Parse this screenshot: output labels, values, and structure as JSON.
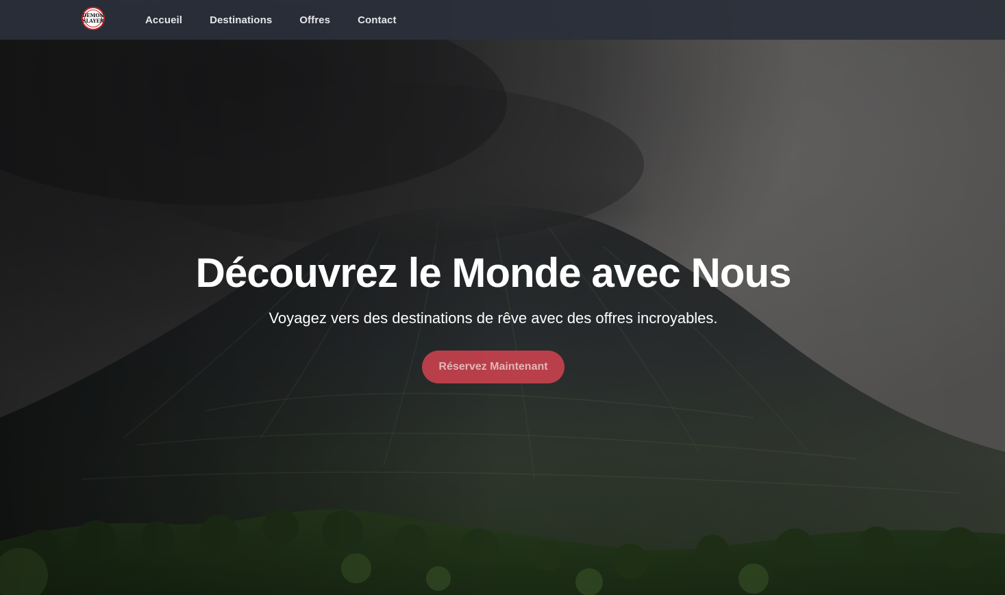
{
  "nav": {
    "logo_alt": "Demon Slayer",
    "logo_text_top": "DEMON",
    "logo_text_bottom": "SLAYER",
    "links": [
      {
        "label": "Accueil"
      },
      {
        "label": "Destinations"
      },
      {
        "label": "Offres"
      },
      {
        "label": "Contact"
      }
    ]
  },
  "hero": {
    "title": "Découvrez le Monde avec Nous",
    "subtitle": "Voyagez vers des destinations de rêve avec des offres incroyables.",
    "cta_label": "Réservez Maintenant"
  },
  "colors": {
    "navbar": "#2b2f3a",
    "cta": "#cd424e",
    "cta_text": "#e2b7b7"
  }
}
